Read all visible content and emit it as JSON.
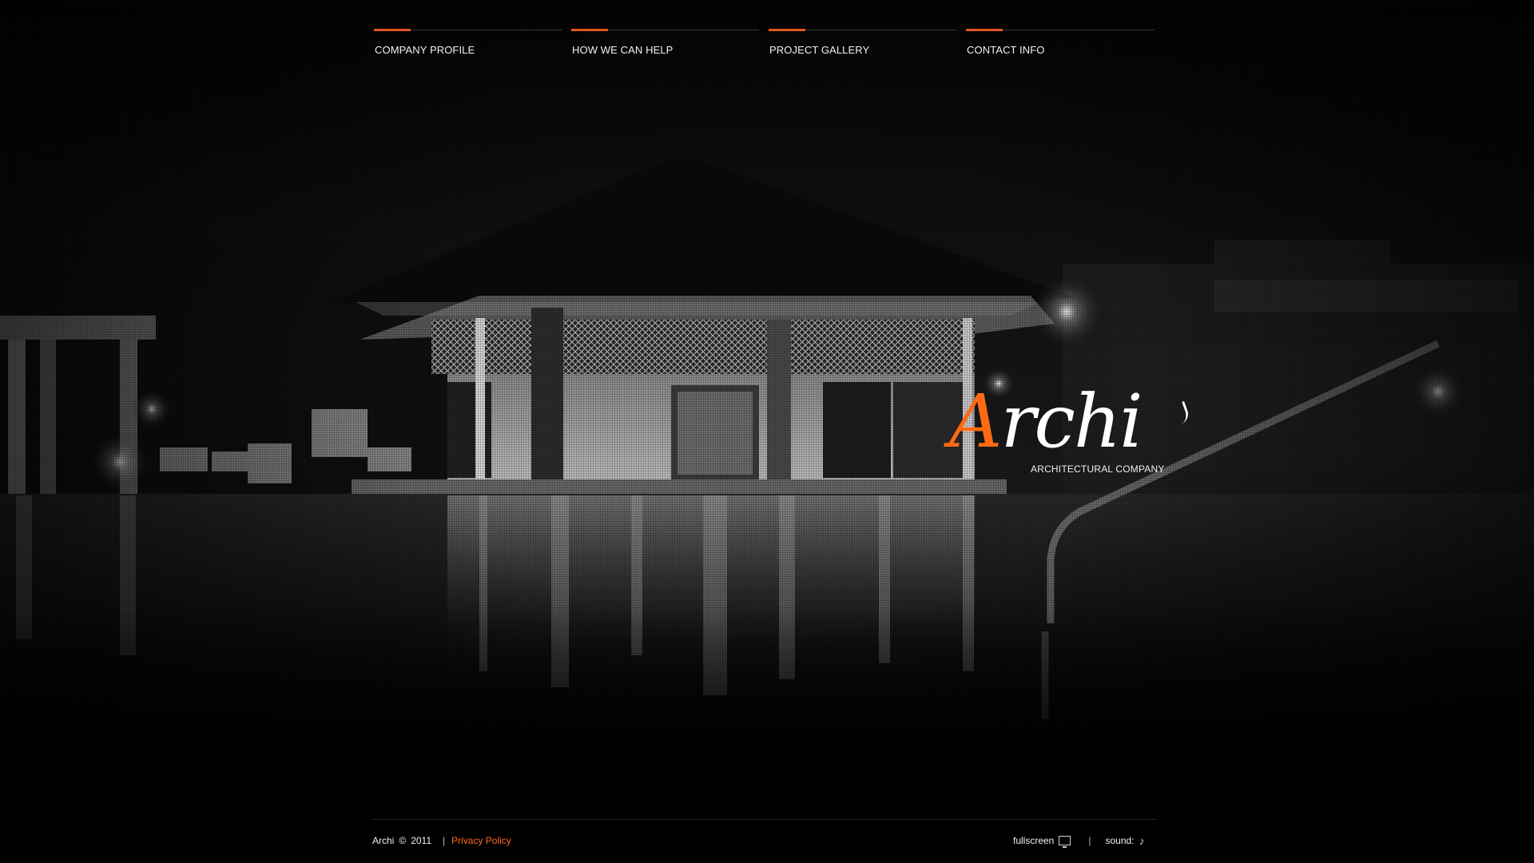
{
  "colors": {
    "accent": "#e2551d",
    "logo_orange": "#ff6a12",
    "background": "#050505"
  },
  "nav": {
    "items": [
      {
        "label": "COMPANY PROFILE"
      },
      {
        "label": "HOW WE CAN HELP"
      },
      {
        "label": "PROJECT GALLERY"
      },
      {
        "label": "CONTACT INFO"
      }
    ]
  },
  "logo": {
    "first_letter": "A",
    "rest": "rchi",
    "tagline": "ARCHITECTURAL COMPANY"
  },
  "footer": {
    "brand": "Archi",
    "copyright_symbol": "©",
    "year": "2011",
    "separator": "|",
    "privacy": "Privacy Policy",
    "fullscreen_label": "fullscreen",
    "sound_label": "sound:",
    "fullscreen_icon": "monitor-icon",
    "sound_icon": "music-note-icon"
  }
}
